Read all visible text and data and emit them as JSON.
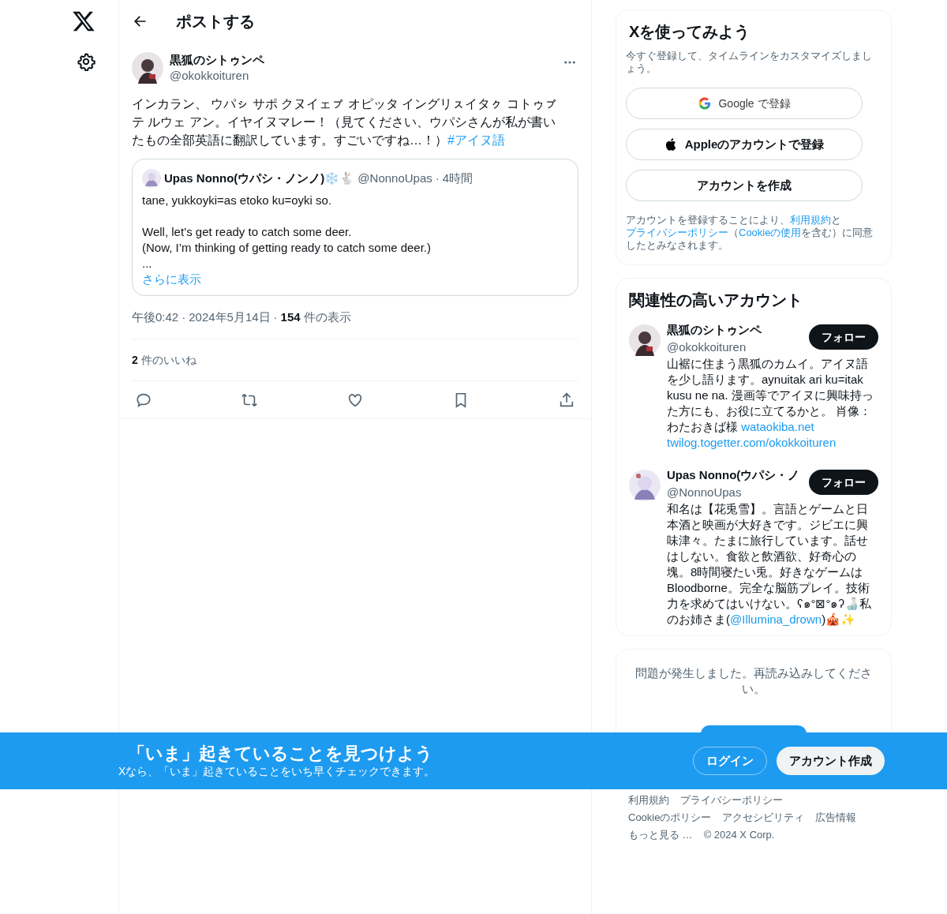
{
  "header": {
    "title": "ポストする"
  },
  "post": {
    "author": {
      "name": "黒狐のシトゥンペ",
      "handle": "@okokkoituren"
    },
    "body": "インカラン、 ウパㇱ サポ クヌイェㇷ゚ オピッタ イングリㇲイタㇰ コトゥㇷ゚テ ルウェ アン。イヤイヌマレー！（見てください、ウパシさんが私が書いたもの全部英語に翻訳しています。すごいですね…！）",
    "hashtag": "#アイヌ語",
    "quote": {
      "name": "Upas Nonno(ウパシ・ノンノ)❄️🐇",
      "handle": "@NonnoUpas",
      "separator": "·",
      "time": "4時間",
      "paragraphs": [
        [
          "tane, yukkoyki=as etoko ku=oyki so."
        ],
        [
          "Well, let’s get ready to catch some deer.",
          "(Now, I’m thinking of getting ready to catch some deer.)",
          "..."
        ]
      ],
      "show_more": "さらに表示"
    },
    "meta": {
      "time": "午後0:42",
      "date": "2024年5月14日",
      "separator": "·",
      "views_count": "154",
      "views_label": "件の表示"
    },
    "likes": {
      "count": "2",
      "label": "件のいいね"
    }
  },
  "signup": {
    "title": "Xを使ってみよう",
    "subtitle": "今すぐ登録して、タイムラインをカスタマイズしましょう。",
    "buttons": [
      {
        "kind": "google",
        "label": "Google で登録"
      },
      {
        "kind": "apple",
        "label": "Appleのアカウントで登録"
      },
      {
        "kind": "create",
        "label": "アカウントを作成"
      }
    ],
    "legal": [
      {
        "text": "アカウントを登録することにより、",
        "link": false
      },
      {
        "text": "利用規約",
        "link": true
      },
      {
        "text": "と",
        "link": false
      },
      {
        "text": "プライバシーポリシー",
        "link": true
      },
      {
        "text": "（",
        "link": false
      },
      {
        "text": "Cookieの使用",
        "link": true
      },
      {
        "text": "を含む）に同意したとみなされます。",
        "link": false
      }
    ]
  },
  "related": {
    "title": "関連性の高いアカウント",
    "accounts": [
      {
        "name": "黒狐のシトゥンペ",
        "handle": "@okokkoituren",
        "follow": "フォロー",
        "bio": [
          {
            "text": "山裾に住まう黒狐のカムイ。アイヌ語を少し語ります。aynuitak ari ku=itak kusu ne na. 漫画等でアイヌに興味持った方にも、お役に立てるかと。 肖像：わたおきば様 ",
            "link": false
          },
          {
            "text": "wataokiba.net",
            "link": true
          },
          {
            "text": "twilog.togetter.com/okokkoituren",
            "link": true
          }
        ]
      },
      {
        "name": "Upas Nonno(ウパシ・ノ",
        "handle": "@NonnoUpas",
        "follow": "フォロー",
        "bio": [
          {
            "text": "和名は【花兎雪】。言語とゲームと日本酒と映画が大好きです。ジビエに興味津々。たまに旅行しています。話せはしない。食欲と飲酒欲、好奇心の塊。8時間寝たい兎。好きなゲームはBloodborne。完全な脳筋プレイ。技術力を求めてはいけない。ʕ๑°⊠°๑ʔ🍶私のお姉さま(",
            "link": false
          },
          {
            "text": "@Illumina_drown",
            "link": true
          },
          {
            "text": ")🎪✨",
            "link": false
          }
        ]
      }
    ]
  },
  "error": {
    "message": "問題が発生しました。再読み込みしてください。"
  },
  "footer": {
    "rows": [
      [
        "利用規約",
        "プライバシーポリシー"
      ],
      [
        "Cookieのポリシー",
        "アクセシビリティ",
        "広告情報"
      ],
      [
        "もっと見る …",
        "© 2024 X Corp."
      ]
    ]
  },
  "banner": {
    "title": "「いま」起きていることを見つけよう",
    "subtitle": "Xなら、「いま」起きていることをいち早くチェックできます。",
    "login": "ログイン",
    "signup": "アカウント作成"
  }
}
